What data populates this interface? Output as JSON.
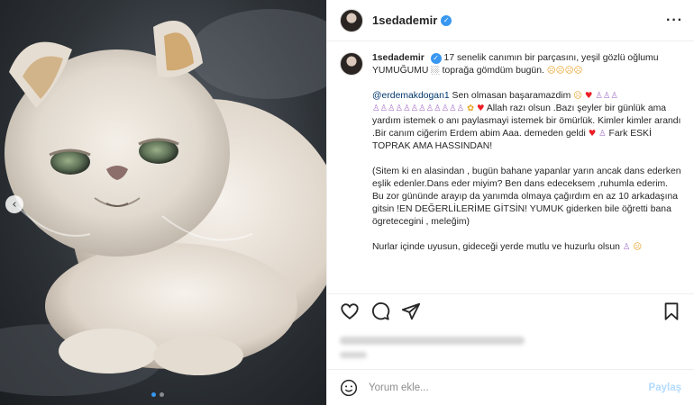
{
  "header": {
    "username": "1sedademir",
    "more_icon": "more-horizontal-icon"
  },
  "media": {
    "prev_icon": "‹",
    "carousel_total": 2,
    "carousel_active": 1
  },
  "caption": {
    "username": "1sedademir",
    "p1": "17 senelik canımın bir parçasını, yeşil gözlü oğlumu YUMUĞUMU",
    "p1_tail": "toprağa gömdüm bugün.",
    "p2_mention": "@erdemakdogan1",
    "p2_a": "Sen olmasan başaramazdim",
    "p2_b": "Allah razı olsun .Bazı şeyler bir günlük ama yardım istemek o anı paylasmayi istemek bir ömürlük. Kimler kimler arandı .Bir canım ciğerim Erdem abim Aaa. demeden geldi",
    "p2_c": "Fark ESKİ TOPRAK AMA HASSINDAN!",
    "p3": "(Sitem ki en alasindan , bugün bahane yapanlar yarın ancak dans ederken eşlik edenler.Dans eder miyim? Ben dans edeceksem ,ruhumla ederim. Bu zor gününde arayıp da yanımda olmaya çağırdım en az 10 arkadaşına gitsin !EN DEĞERLİLERİME GİTSİN! YUMUK giderken bile öğretti bana ögretecegini , meleğim)",
    "p4": "Nurlar içinde uyusun, gideceği yerde mutlu ve huzurlu olsun"
  },
  "actions": {
    "like_icon": "heart-outline-icon",
    "comment_icon": "comment-icon",
    "share_icon": "share-icon",
    "save_icon": "bookmark-icon"
  },
  "comment": {
    "placeholder": "Yorum ekle...",
    "post_label": "Paylaş",
    "emoji_icon": "smiley-icon"
  },
  "colors": {
    "accent": "#3897f0",
    "post_disabled": "#b3dbff",
    "mention": "#00376b"
  }
}
